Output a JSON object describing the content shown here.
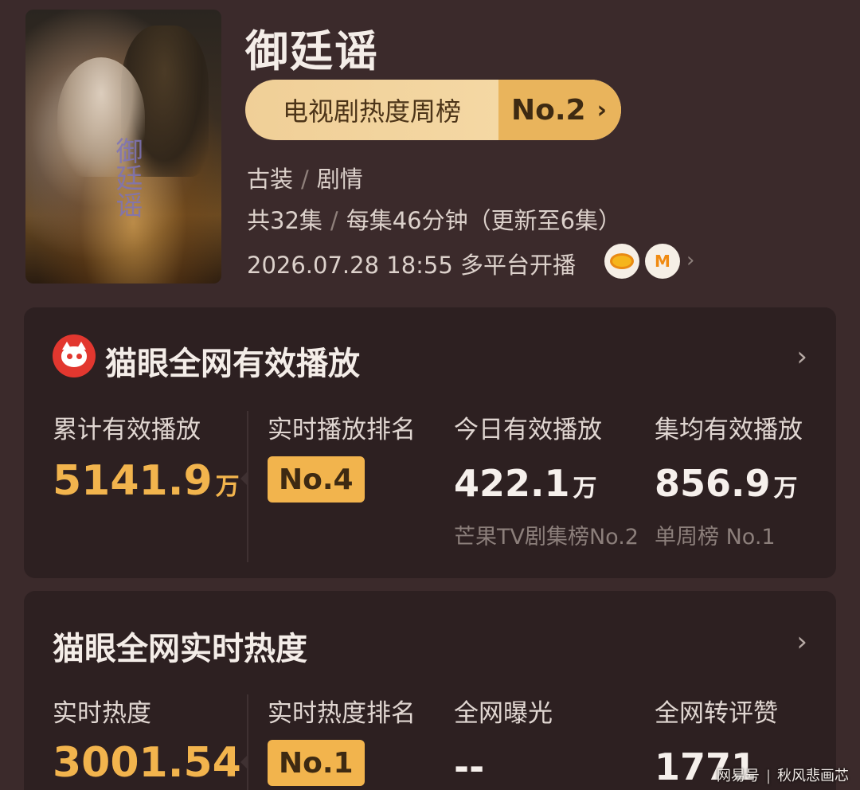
{
  "show": {
    "title": "御廷谣",
    "poster_caption": "御廷谣",
    "rank_label": "电视剧热度周榜",
    "rank_value": "No.2",
    "genre": [
      "古装",
      "剧情"
    ],
    "episodes": "共32集",
    "episode_length": "每集46分钟（更新至6集）",
    "premiere": "2026.07.28 18:55 多平台开播",
    "platform_icons": [
      "hunan-tv-icon",
      "mango-tv-icon"
    ]
  },
  "plays_card": {
    "title": "猫眼全网有效播放",
    "stats": [
      {
        "label": "累计有效播放",
        "value": "5141.9",
        "unit": "万"
      },
      {
        "label": "实时播放排名",
        "value": "No.4"
      },
      {
        "label": "今日有效播放",
        "value": "422.1",
        "unit": "万",
        "sub": "芒果TV剧集榜No.2"
      },
      {
        "label": "集均有效播放",
        "value": "856.9",
        "unit": "万",
        "sub": "单周榜 No.1"
      }
    ]
  },
  "heat_card": {
    "title": "猫眼全网实时热度",
    "stats": [
      {
        "label": "实时热度",
        "value": "3001.54"
      },
      {
        "label": "实时热度排名",
        "value": "No.1"
      },
      {
        "label": "全网曝光",
        "value": "--"
      },
      {
        "label": "全网转评赞",
        "value": "1771"
      }
    ]
  },
  "watermark": {
    "left": "网易号",
    "right": "秋风悲画芯"
  },
  "colors": {
    "background": "#3b2a2b",
    "card": "#2d2021",
    "gold": "#f2b44d",
    "pill": "#f0cf97",
    "logo_red": "#e2372f"
  }
}
